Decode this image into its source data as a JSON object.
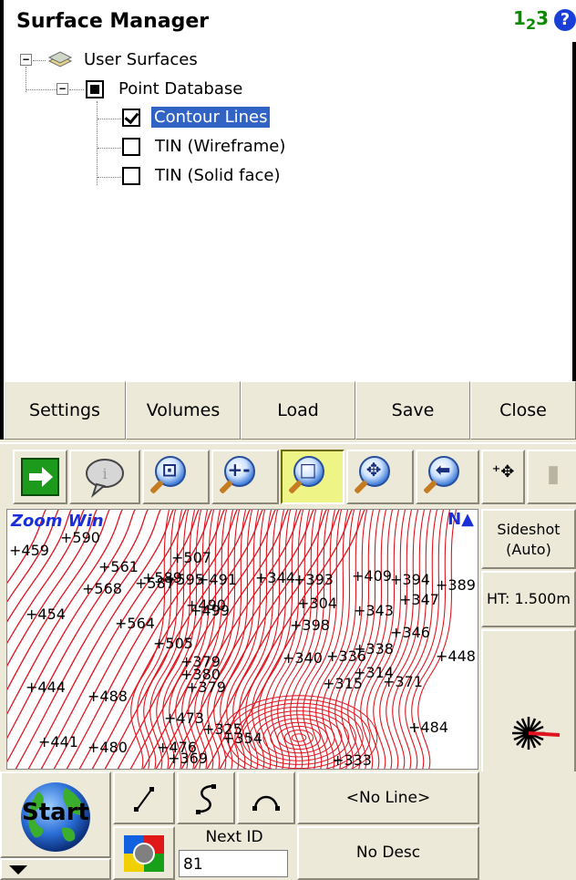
{
  "surface_manager": {
    "title": "Surface Manager",
    "mode_indicator": "1",
    "mode_indicator_sub": "2",
    "mode_indicator_tail": "3",
    "help": "?",
    "tree": {
      "root": "User Surfaces",
      "child": "Point Database",
      "items": [
        {
          "label": "Contour Lines",
          "checked": true,
          "selected": true
        },
        {
          "label": "TIN (Wireframe)",
          "checked": false,
          "selected": false
        },
        {
          "label": "TIN (Solid face)",
          "checked": false,
          "selected": false
        }
      ]
    },
    "buttons": [
      "Settings",
      "Volumes",
      "Load",
      "Save",
      "Close"
    ]
  },
  "toolbar": {
    "icons": [
      "next-arrow-icon",
      "info-balloon-icon",
      "zoom-extents-icon",
      "zoom-in-out-icon",
      "zoom-window-icon",
      "pan-icon",
      "zoom-previous-icon",
      "point-crosshair-icon",
      "instrument-icon"
    ],
    "active": "zoom-window-icon"
  },
  "map": {
    "mode_label": "Zoom Win",
    "north_label": "N",
    "point_labels": [
      "+459",
      "+590",
      "+507",
      "+561",
      "+589",
      "+491",
      "+568",
      "+587",
      "+595",
      "+490",
      "+344",
      "+393",
      "+409",
      "+394",
      "+389",
      "+454",
      "+564",
      "+499",
      "+398",
      "+304",
      "+343",
      "+347",
      "+346",
      "+505",
      "+379",
      "+340",
      "+336",
      "+338",
      "+314",
      "+448",
      "+380",
      "+444",
      "+488",
      "+379",
      "+315",
      "+371",
      "+473",
      "+325",
      "+354",
      "+484",
      "+441",
      "+480",
      "+476",
      "+369",
      "+333"
    ],
    "contour_color": "#e0141e"
  },
  "right_panel": {
    "sideshot": "Sideshot",
    "sideshot_mode": "(Auto)",
    "ht": "HT: 1.500m"
  },
  "bottom": {
    "start": "Start",
    "no_line": "<No Line>",
    "next_id_label": "Next ID",
    "next_id_value": "81",
    "no_desc": "No Desc"
  }
}
